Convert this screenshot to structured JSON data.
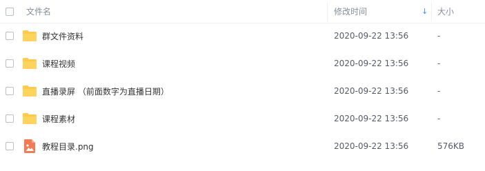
{
  "header": {
    "name_label": "文件名",
    "time_label": "修改时间",
    "size_label": "大小",
    "sort_indicator": "↓"
  },
  "rows": [
    {
      "name": "群文件资料",
      "time": "2020-09-22 13:56",
      "size": "-",
      "icon": "folder-icon"
    },
    {
      "name": "课程视频",
      "time": "2020-09-22 13:56",
      "size": "-",
      "icon": "folder-icon"
    },
    {
      "name": "直播录屏 （前面数字为直播日期）",
      "time": "2020-09-22 13:56",
      "size": "-",
      "icon": "folder-icon"
    },
    {
      "name": "课程素材",
      "time": "2020-09-22 13:56",
      "size": "-",
      "icon": "folder-icon"
    },
    {
      "name": "教程目录.png",
      "time": "2020-09-22 13:56",
      "size": "576KB",
      "icon": "image-file-icon"
    }
  ],
  "colors": {
    "folder": "#ffc94d",
    "image_icon": "#f27b54",
    "accent": "#3b8cff"
  }
}
